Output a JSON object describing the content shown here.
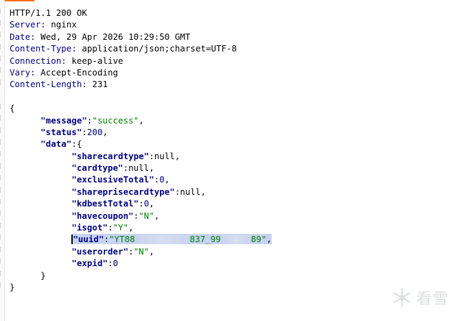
{
  "response": {
    "status_line": "HTTP/1.1 200 OK",
    "headers": [
      {
        "name": "Server",
        "value": "nginx"
      },
      {
        "name": "Date",
        "value": "Wed, 29 Apr 2026 10:29:50 GMT"
      },
      {
        "name": "Content-Type",
        "value": "application/json;charset=UTF-8"
      },
      {
        "name": "Connection",
        "value": "keep-alive"
      },
      {
        "name": "Vary",
        "value": "Accept-Encoding"
      },
      {
        "name": "Content-Length",
        "value": "231"
      }
    ]
  },
  "json": {
    "open_brace": "{",
    "message_key": "\"message\"",
    "message_val": "\"success\"",
    "status_key": "\"status\"",
    "status_val": "200",
    "data_key": "\"data\"",
    "data_open": "{",
    "fields": {
      "sharecardtype": {
        "key": "\"sharecardtype\"",
        "val": "null"
      },
      "cardtype": {
        "key": "\"cardtype\"",
        "val": "null"
      },
      "exclusiveTotal": {
        "key": "\"exclusiveTotal\"",
        "val": "0"
      },
      "shareprisecardtype": {
        "key": "\"shareprisecardtype\"",
        "val": "null"
      },
      "kdbestTotal": {
        "key": "\"kdbestTotal\"",
        "val": "0"
      },
      "havecoupon": {
        "key": "\"havecoupon\"",
        "val": "\"N\""
      },
      "isgot": {
        "key": "\"isgot\"",
        "val": "\"Y\""
      },
      "uuid": {
        "key": "\"uuid\"",
        "val_part1": "\"YT88",
        "val_part2": "837_99",
        "val_part3": "89\""
      },
      "userorder": {
        "key": "\"userorder\"",
        "val": "\"N\""
      },
      "expid": {
        "key": "\"expid\"",
        "val": "0"
      }
    },
    "data_close": "}",
    "close_brace": "}"
  },
  "watermark": {
    "text": "看雪"
  }
}
